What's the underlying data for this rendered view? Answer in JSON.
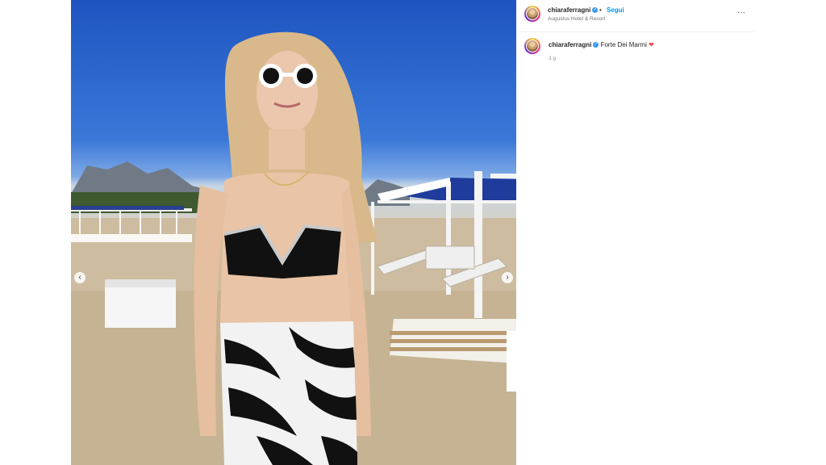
{
  "post": {
    "username": "chiaraferragni",
    "separator": "•",
    "follow_label": "Segui",
    "location": "Augustus Hotel & Resort",
    "more_glyph": "···"
  },
  "caption": {
    "username": "chiaraferragni",
    "text": "Forte Dei Marmi",
    "emoji": "❤",
    "time": "3 g"
  },
  "nav": {
    "prev_glyph": "‹",
    "next_glyph": "›"
  },
  "colors": {
    "link": "#0095f6",
    "verified": "#3897f0",
    "heart": "#ed4956"
  }
}
